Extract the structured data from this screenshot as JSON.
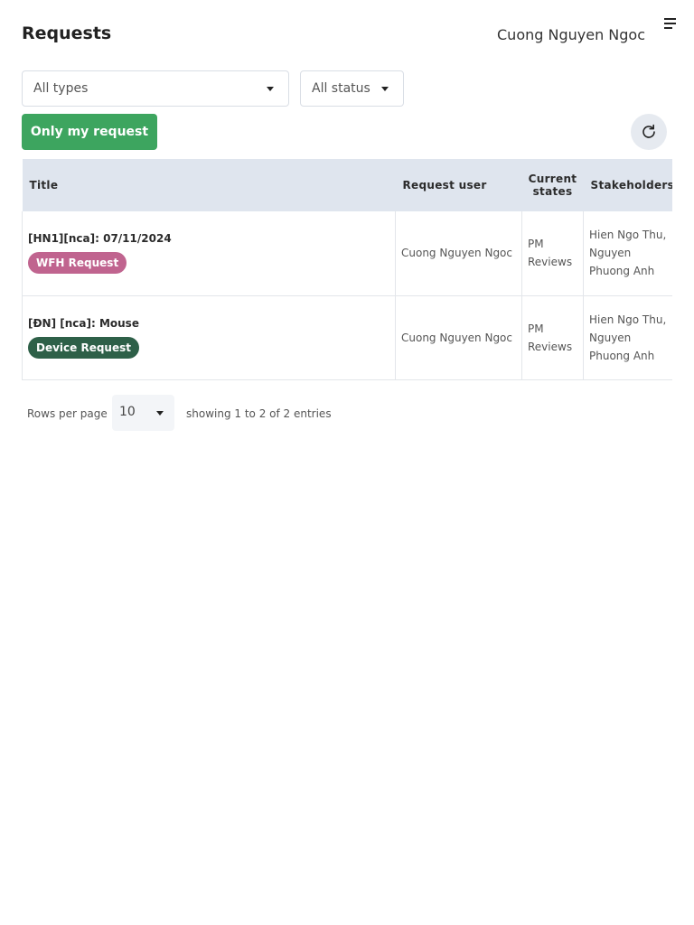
{
  "header": {
    "title": "Requests",
    "user_name": "Cuong Nguyen Ngoc",
    "menu_icon": "hamburger-menu-icon"
  },
  "filters": {
    "types_value": "All types",
    "status_value": "All status"
  },
  "actions": {
    "only_mine_label": "Only my request",
    "refresh_icon": "refresh-icon"
  },
  "table": {
    "columns": [
      "Title",
      "Request user",
      "Current states",
      "Stakeholders"
    ],
    "rows": [
      {
        "title": "[HN1][nca]: 07/11/2024",
        "badge": "WFH Request",
        "badge_color": "#c0648f",
        "request_user": "Cuong Nguyen Ngoc",
        "state": "PM Reviews",
        "stakeholders": "Hien Ngo Thu, Nguyen Phuong Anh"
      },
      {
        "title": "[ĐN] [nca]: Mouse",
        "badge": "Device Request",
        "badge_color": "#2e6048",
        "request_user": "Cuong Nguyen Ngoc",
        "state": "PM Reviews",
        "stakeholders": "Hien Ngo Thu, Nguyen Phuong Anh"
      }
    ]
  },
  "pagination": {
    "rows_per_page_label": "Rows per page",
    "rows_per_page_value": "10",
    "showing_text": "showing 1 to 2 of 2 entries"
  },
  "colors": {
    "primary_green": "#3da55f",
    "table_header_bg": "#dfe5ee"
  }
}
